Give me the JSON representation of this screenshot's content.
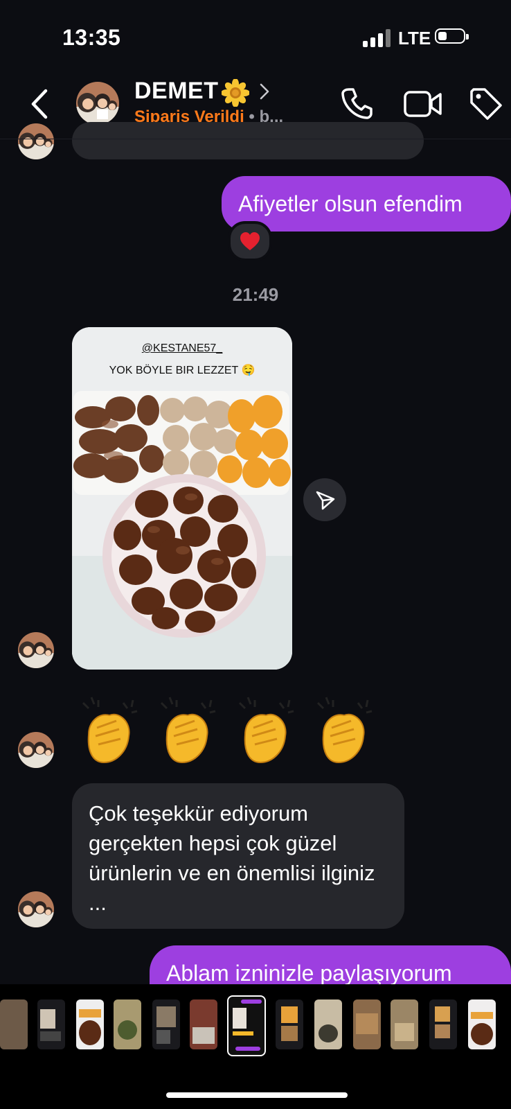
{
  "status_bar": {
    "time": "13:35",
    "network": "LTE"
  },
  "header": {
    "contact_name": "DEMET",
    "status": "Sipariş Verildi",
    "status_suffix": "• b..."
  },
  "messages": {
    "first_outgoing": "Afiyetler olsun efendim",
    "reaction": "❤️",
    "timestamp": "21:49",
    "shared_post": {
      "handle": "@KESTANE57_",
      "caption": "YOK BÖYLE BIR LEZZET 🤤"
    },
    "claps": "👏👏👏👏",
    "incoming_text": "Çok teşekkür ediyorum gerçekten hepsi çok güzel ürünlerin ve en önemlisi ilginiz ...",
    "last_outgoing": "Ablam izninizle paylaşıyorum"
  },
  "colors": {
    "background": "#0c0d12",
    "outgoing_bubble": "#9d3fe0",
    "incoming_bubble": "#26272c",
    "status_orange": "#ff7a1a"
  },
  "icons": [
    "back-chevron-icon",
    "sunflower-icon",
    "phone-icon",
    "video-camera-icon",
    "tag-icon",
    "send-icon",
    "heart-icon"
  ],
  "thumbnail_strip": {
    "count": 13,
    "selected_index": 6
  }
}
